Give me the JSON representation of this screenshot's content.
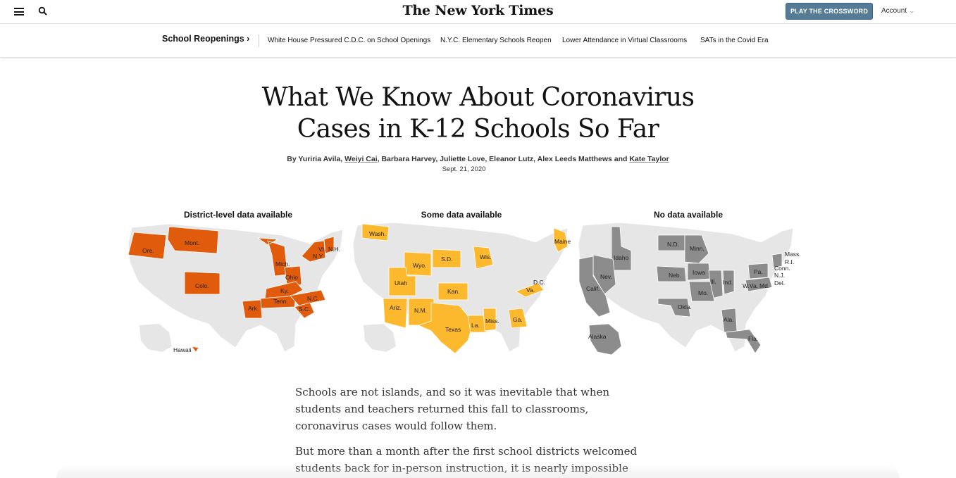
{
  "masthead": {
    "logo": "The New York Times",
    "crossword_button": "PLAY THE CROSSWORD",
    "account_label": "Account",
    "icons": [
      "menu-icon",
      "search-icon",
      "chevron-down-icon"
    ]
  },
  "subnav": {
    "title": "School Reopenings ›",
    "links": [
      "White House Pressured C.D.C. on School Openings",
      "N.Y.C. Elementary Schools Reopen",
      "Lower Attendance in Virtual Classrooms",
      "SATs in the Covid Era"
    ]
  },
  "article": {
    "headline_line1": "What We Know About Coronavirus",
    "headline_line2": "Cases in K-12 Schools So Far",
    "byline_prefix": "By Yuriria Avila, ",
    "byline_link1": "Weiyi Cai",
    "byline_middle": ", Barbara Harvey, Juliette Love, Eleanor Lutz, Alex Leeds Matthews and ",
    "byline_link2": "Kate Taylor",
    "date": "Sept. 21, 2020",
    "paragraph1": "Schools are not islands, and so it was inevitable that when students and teachers returned this fall to classrooms, coronavirus cases would follow them.",
    "paragraph2": "But more than a month after the first school districts welcomed students back for in-person instruction, it is nearly impossible to"
  },
  "maps": {
    "colors": {
      "base": "#e6e6e6",
      "district": "#e05b0c",
      "some": "#fdb92e",
      "none": "#8c8c8c"
    },
    "titles": [
      "District-level data available",
      "Some data available",
      "No data available"
    ],
    "district_states": [
      "Ore.",
      "Mont.",
      "Colo.",
      "Mich.",
      "Ohio",
      "Ky.",
      "Tenn.",
      "Ark.",
      "N.C.",
      "S.C.",
      "N.Y.",
      "Vt.",
      "N.H.",
      "Hawaii"
    ],
    "some_states": [
      "Wash.",
      "Wyo.",
      "S.D.",
      "Wis.",
      "Maine",
      "Utah",
      "Kan.",
      "D.C.",
      "Va.",
      "Ariz.",
      "N.M.",
      "Texas",
      "La.",
      "Miss.",
      "Ga."
    ],
    "none_states": [
      "Idaho",
      "N.D.",
      "Minn.",
      "Mass.",
      "R.I.",
      "Conn.",
      "N.J.",
      "Del.",
      "Nev.",
      "Neb.",
      "Iowa",
      "Pa.",
      "Calif.",
      "Ill.",
      "Ind.",
      "W.Va.",
      "Md.",
      "Mo.",
      "Okla.",
      "Ala.",
      "Alaska",
      "Fla."
    ]
  }
}
